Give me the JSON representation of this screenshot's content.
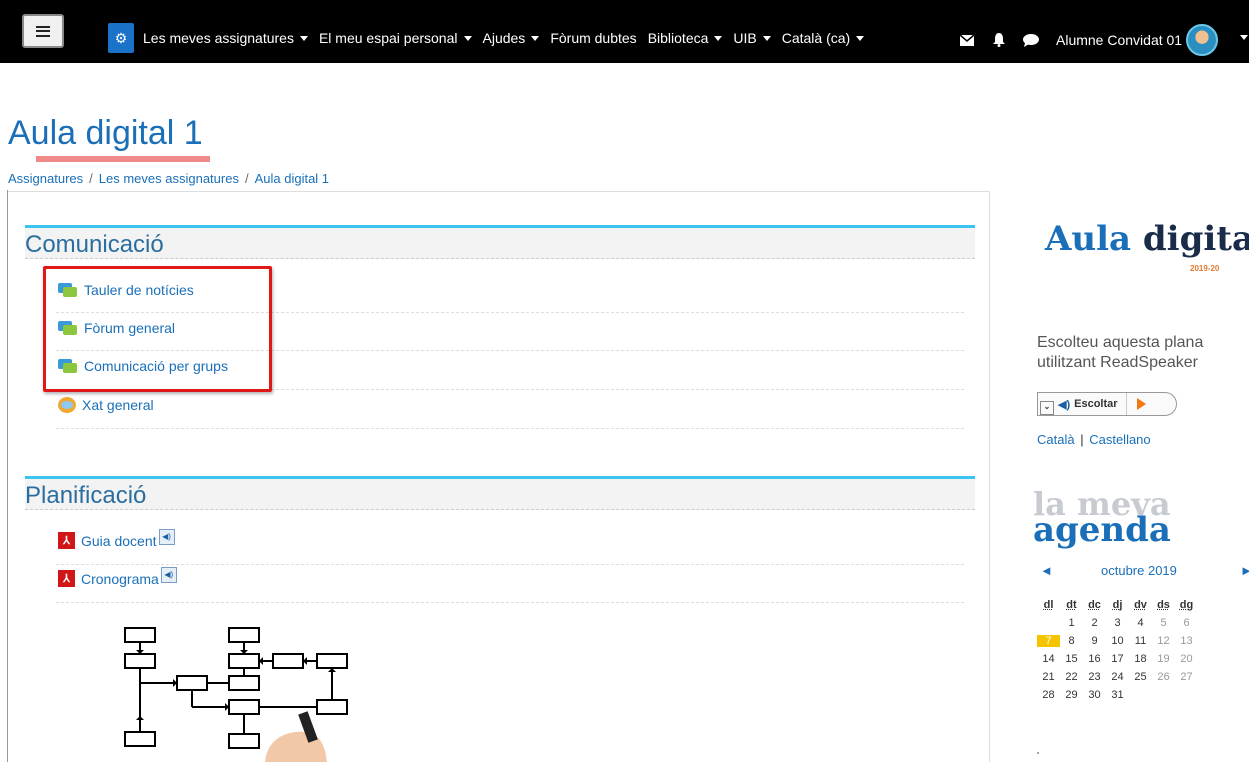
{
  "navbar": {
    "menu_icon": "hamburger-icon",
    "brand_icon": "cogs-icon",
    "items": [
      {
        "label": "Les meves assignatures"
      },
      {
        "label": "El meu espai personal"
      },
      {
        "label": "Ajudes"
      },
      {
        "label": "Fòrum dubtes"
      },
      {
        "label": "Biblioteca"
      },
      {
        "label": "UIB"
      },
      {
        "label": "Català (ca)"
      }
    ],
    "user_name": "Alumne Convidat 01"
  },
  "page": {
    "title": "Aula digital 1",
    "breadcrumb": [
      "Assignatures",
      "Les meves assignatures",
      "Aula digital 1"
    ],
    "breadcrumb_sep": "/"
  },
  "sections": {
    "comunicacio": {
      "title": "Comunicació",
      "items": [
        {
          "label": "Tauler de notícies",
          "icon": "forum-icon"
        },
        {
          "label": "Fòrum general",
          "icon": "forum-icon"
        },
        {
          "label": "Comunicació per grups",
          "icon": "forum-icon"
        },
        {
          "label": "Xat general",
          "icon": "chat-icon"
        }
      ]
    },
    "planificacio": {
      "title": "Planificació",
      "items": [
        {
          "label": "Guia docent",
          "icon": "pdf-icon"
        },
        {
          "label": "Cronograma",
          "icon": "pdf-icon"
        }
      ]
    }
  },
  "sidebar": {
    "logo_word1": "Aula",
    "logo_word2": "digital",
    "logo_year": "2019-20",
    "readspeaker_text": "Escolteu aquesta plana utilitzant ReadSpeaker",
    "listen_label": "Escoltar",
    "lang_ca": "Català",
    "lang_sep": "|",
    "lang_es": "Castellano",
    "agenda_line1": "la meva",
    "agenda_line2": "agenda"
  },
  "calendar": {
    "month": "octubre 2019",
    "prev_symbol": "◄",
    "next_symbol": "►",
    "weekdays": [
      "dl",
      "dt",
      "dc",
      "dj",
      "dv",
      "ds",
      "dg"
    ],
    "today": "7",
    "weeks": [
      [
        "",
        "1",
        "2",
        "3",
        "4",
        "5",
        "6"
      ],
      [
        "7",
        "8",
        "9",
        "10",
        "11",
        "12",
        "13"
      ],
      [
        "14",
        "15",
        "16",
        "17",
        "18",
        "19",
        "20"
      ],
      [
        "21",
        "22",
        "23",
        "24",
        "25",
        "26",
        "27"
      ],
      [
        "28",
        "29",
        "30",
        "31",
        "",
        "",
        ""
      ]
    ]
  },
  "colors": {
    "navbar_bg": "#000000",
    "link": "#1a6fb8",
    "section_accent": "#3ac4ef",
    "highlight": "#e01818",
    "today": "#f5c400"
  }
}
